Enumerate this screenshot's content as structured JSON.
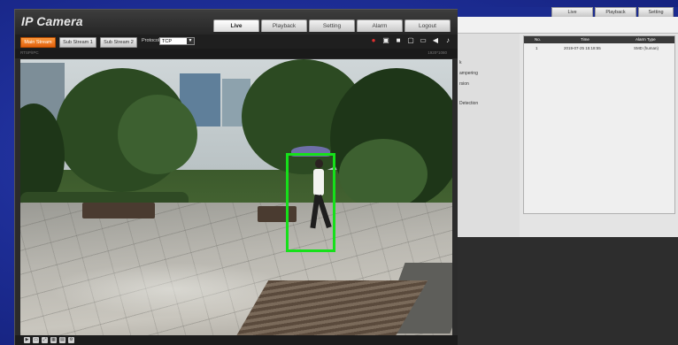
{
  "left_window": {
    "logo": "IP Camera",
    "tabs": [
      {
        "label": "Live",
        "active": true
      },
      {
        "label": "Playback",
        "active": false
      },
      {
        "label": "Setting",
        "active": false
      },
      {
        "label": "Alarm",
        "active": false
      },
      {
        "label": "Logout",
        "active": false
      }
    ],
    "streams": {
      "main": "Main Stream",
      "sub1": "Sub Stream 1",
      "sub2": "Sub Stream 2",
      "protocol_label": "Protocol",
      "protocol_value": "TCP"
    },
    "toolbar_icons": [
      "record-icon",
      "snapshot-icon",
      "fullscreen-icon",
      "window-icon",
      "zoom-icon",
      "audio-icon",
      "mic-icon"
    ],
    "substrip": {
      "left": "RTSP/IPC",
      "right": "1920*1080"
    },
    "bottom_icons": [
      "play-icon",
      "ratio-icon",
      "fit-icon",
      "layout-icon",
      "stream-icon",
      "settings-icon"
    ],
    "detection": {
      "label": "SMD (human)",
      "color": "#16e01a"
    }
  },
  "right_window": {
    "tabs": [
      "Live",
      "Playback",
      "Setting"
    ],
    "side_items": [
      "k",
      "ampering",
      "rsion",
      "Detection"
    ],
    "alarm_table": {
      "headers": [
        "No.",
        "Time",
        "Alarm Type"
      ],
      "rows": [
        {
          "no": "1",
          "time": "2019-07-25 15:18:55",
          "type": "SMD (human)"
        }
      ]
    }
  }
}
